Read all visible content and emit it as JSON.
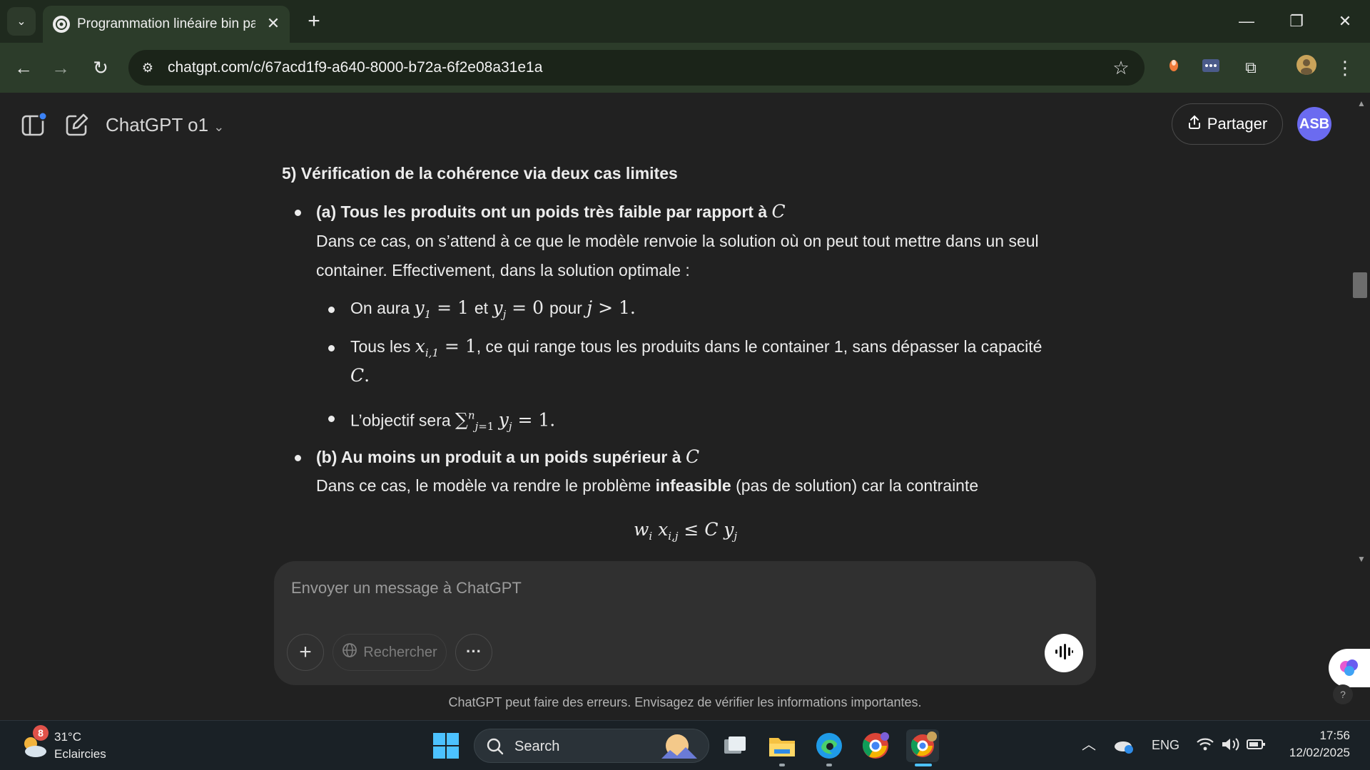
{
  "browser": {
    "tab_title": "Programmation linéaire bin pac",
    "url": "chatgpt.com/c/67acd1f9-a640-8000-b72a-6f2e08a31e1a"
  },
  "header": {
    "model": "ChatGPT o1",
    "share_label": "Partager",
    "avatar_initials": "ASB"
  },
  "content": {
    "section_title": "5) Vérification de la cohérence via deux cas limites",
    "case_a": {
      "title": "(a) Tous les produits ont un poids très faible par rapport à",
      "para_line1": "Dans ce cas, on s’attend à ce que le modèle renvoie la solution où on peut tout mettre dans un seul",
      "para_line2": "container. Effectivement, dans la solution optimale :",
      "item1_prefix": "On aura",
      "item1_mid": "et",
      "item1_mid2": "pour",
      "item2_prefix": "Tous les",
      "item2_text": ", ce qui range tous les produits dans le container 1, sans dépasser la capacité",
      "item3_prefix": "L’objectif sera"
    },
    "case_b": {
      "title": "(b) Au moins un produit a un poids supérieur à",
      "para_prefix": "Dans ce cas, le modèle va rendre le problème",
      "para_bold": "infeasible",
      "para_suffix": "(pas de solution) car la contrainte"
    }
  },
  "composer": {
    "placeholder": "Envoyer un message à ChatGPT",
    "search_label": "Rechercher"
  },
  "disclaimer": "ChatGPT peut faire des erreurs. Envisagez de vérifier les informations importantes.",
  "taskbar": {
    "weather_badge": "8",
    "temperature": "31°C",
    "weather_desc": "Eclaircies",
    "search_label": "Search",
    "language": "ENG",
    "time": "17:56",
    "date": "12/02/2025"
  },
  "colors": {
    "tabbar": "#1f2a1e",
    "navbar": "#2c3c2a",
    "page_bg": "#212121",
    "composer_bg": "#303030",
    "avatar": "#6b6bf0"
  }
}
